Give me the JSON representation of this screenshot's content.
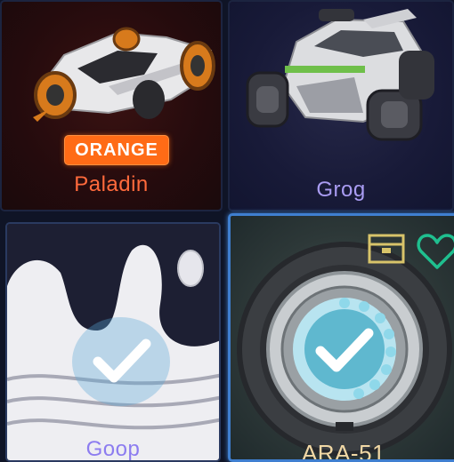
{
  "items": [
    {
      "name": "Paladin",
      "badge": "ORANGE",
      "name_color": "#ff6a3c",
      "icon": "car-paladin-icon"
    },
    {
      "name": "Grog",
      "name_color": "#a99cf2",
      "icon": "car-grog-icon"
    },
    {
      "name": "Goop",
      "name_color": "#8c7cf0",
      "icon": "decal-icon",
      "equipped": true
    },
    {
      "name": "ARA-51",
      "name_color": "#f1d8a5",
      "icon": "wheel-icon",
      "equipped": true,
      "selected": true,
      "tags": [
        "crate-icon",
        "favorite-heart-icon"
      ]
    }
  ],
  "colors": {
    "selection": "#3f7fd0",
    "favorite": "#1fbf8f",
    "crate": "#d8c46a",
    "badge": "#ff6b16"
  }
}
